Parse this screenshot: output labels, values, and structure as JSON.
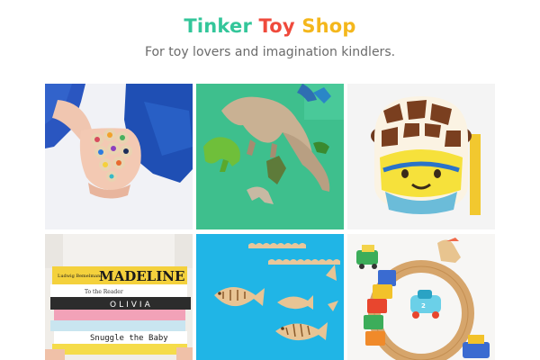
{
  "header": {
    "title_parts": [
      {
        "text": "Tinker",
        "color": "#33c69a"
      },
      {
        "text": "Toy",
        "color": "#ef4a3c"
      },
      {
        "text": "Shop",
        "color": "#f4b71c"
      }
    ],
    "tagline": "For toy lovers and imagination kindlers."
  },
  "gallery": {
    "books": {
      "title_1": "MADELINE",
      "author_1": "Ludwig Bemelmans",
      "spine_2": "OLIVIA",
      "title_3": "Snuggle the Baby",
      "small_1": "To the Reader"
    }
  },
  "colors": {
    "tagline": "#6b6b6b",
    "crayon_bg": "#f1f2f6",
    "dino_bg": "#3ebf8d",
    "giraffe_bg": "#f4f4f4",
    "fish_bg": "#20b5e6",
    "train_bg": "#f7f6f4"
  }
}
